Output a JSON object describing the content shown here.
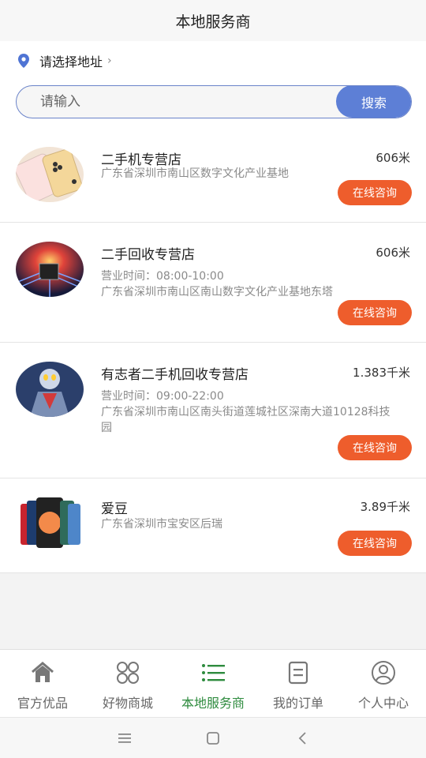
{
  "header": {
    "title": "本地服务商"
  },
  "location": {
    "label": "请选择地址",
    "chevron": "›"
  },
  "search": {
    "placeholder": "请输入",
    "button_label": "搜索"
  },
  "stores": [
    {
      "name": "二手机专营店",
      "distance": "606米",
      "address": "广东省深圳市南山区数字文化产业基地",
      "button": "在线咨询",
      "image": "phones-pink-gold"
    },
    {
      "name": "二手回收专营店",
      "distance": "606米",
      "hours": "营业时间：08:00-10:00",
      "address": "广东省深圳市南山区南山数字文化产业基地东塔",
      "button": "在线咨询",
      "image": "circuit-chip"
    },
    {
      "name": "有志者二手机回收专营店",
      "distance": "1.383千米",
      "hours": "营业时间：09:00-22:00",
      "address": "广东省深圳市南山区南头街道莲城社区深南大道10128科技园",
      "button": "在线咨询",
      "image": "armored-hero"
    },
    {
      "name": "爱豆",
      "distance": "3.89千米",
      "address": "广东省深圳市宝安区后瑞",
      "button": "在线咨询",
      "image": "colorful-phones"
    }
  ],
  "tabs": [
    {
      "label": "官方优品",
      "icon": "home-icon",
      "active": false
    },
    {
      "label": "好物商城",
      "icon": "grid-icon",
      "active": false
    },
    {
      "label": "本地服务商",
      "icon": "list-icon",
      "active": true
    },
    {
      "label": "我的订单",
      "icon": "order-icon",
      "active": false
    },
    {
      "label": "个人中心",
      "icon": "user-icon",
      "active": false
    }
  ],
  "colors": {
    "accent_blue": "#5d7fd6",
    "consult_orange": "#ee5d2c",
    "active_green": "#2e8b3e"
  }
}
